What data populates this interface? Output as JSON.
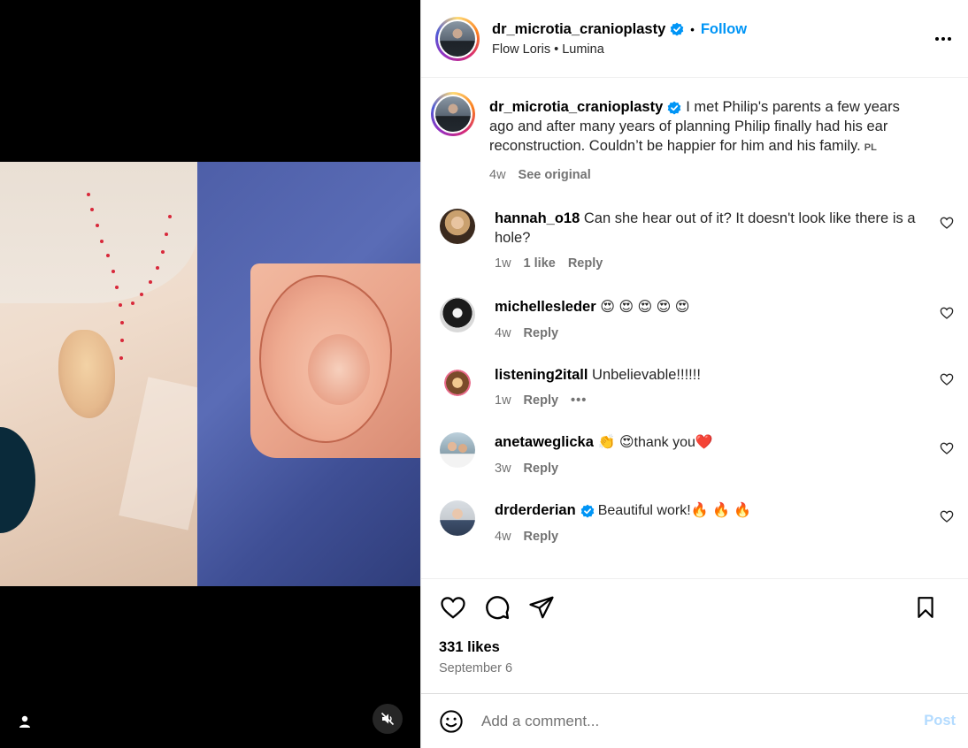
{
  "header": {
    "username": "dr_microtia_cranioplasty",
    "follow_label": "Follow",
    "separator": "•",
    "subtitle": "Flow Loris • Lumina"
  },
  "caption": {
    "username": "dr_microtia_cranioplasty",
    "text": "I met Philip's parents a few years ago and after many years of planning Philip finally had his ear reconstruction. Couldn’t be happier for him and his family.",
    "lang_tag": "PL",
    "age": "4w",
    "see_original": "See original"
  },
  "comments": [
    {
      "username": "hannah_o18",
      "text": "Can she hear out of it? It doesn't look like there is a hole?",
      "age": "1w",
      "likes": "1 like",
      "reply": "Reply"
    },
    {
      "username": "michellesleder",
      "text": "😍 😍 😍 😍 😍",
      "age": "4w",
      "reply": "Reply"
    },
    {
      "username": "listening2itall",
      "text": "Unbelievable!!!!!!",
      "age": "1w",
      "reply": "Reply",
      "more": "•••"
    },
    {
      "username": "anetaweglicka",
      "text": "👏 😍thank you❤️",
      "age": "3w",
      "reply": "Reply"
    },
    {
      "username": "drderderian",
      "text": "Beautiful work!🔥 🔥 🔥",
      "age": "4w",
      "reply": "Reply"
    }
  ],
  "engagement": {
    "likes": "331 likes",
    "date": "September 6"
  },
  "composer": {
    "placeholder": "Add a comment...",
    "post_label": "Post"
  },
  "colors": {
    "accent": "#0095f6",
    "post_disabled": "#b3dbff",
    "verified": "#0095f6"
  }
}
